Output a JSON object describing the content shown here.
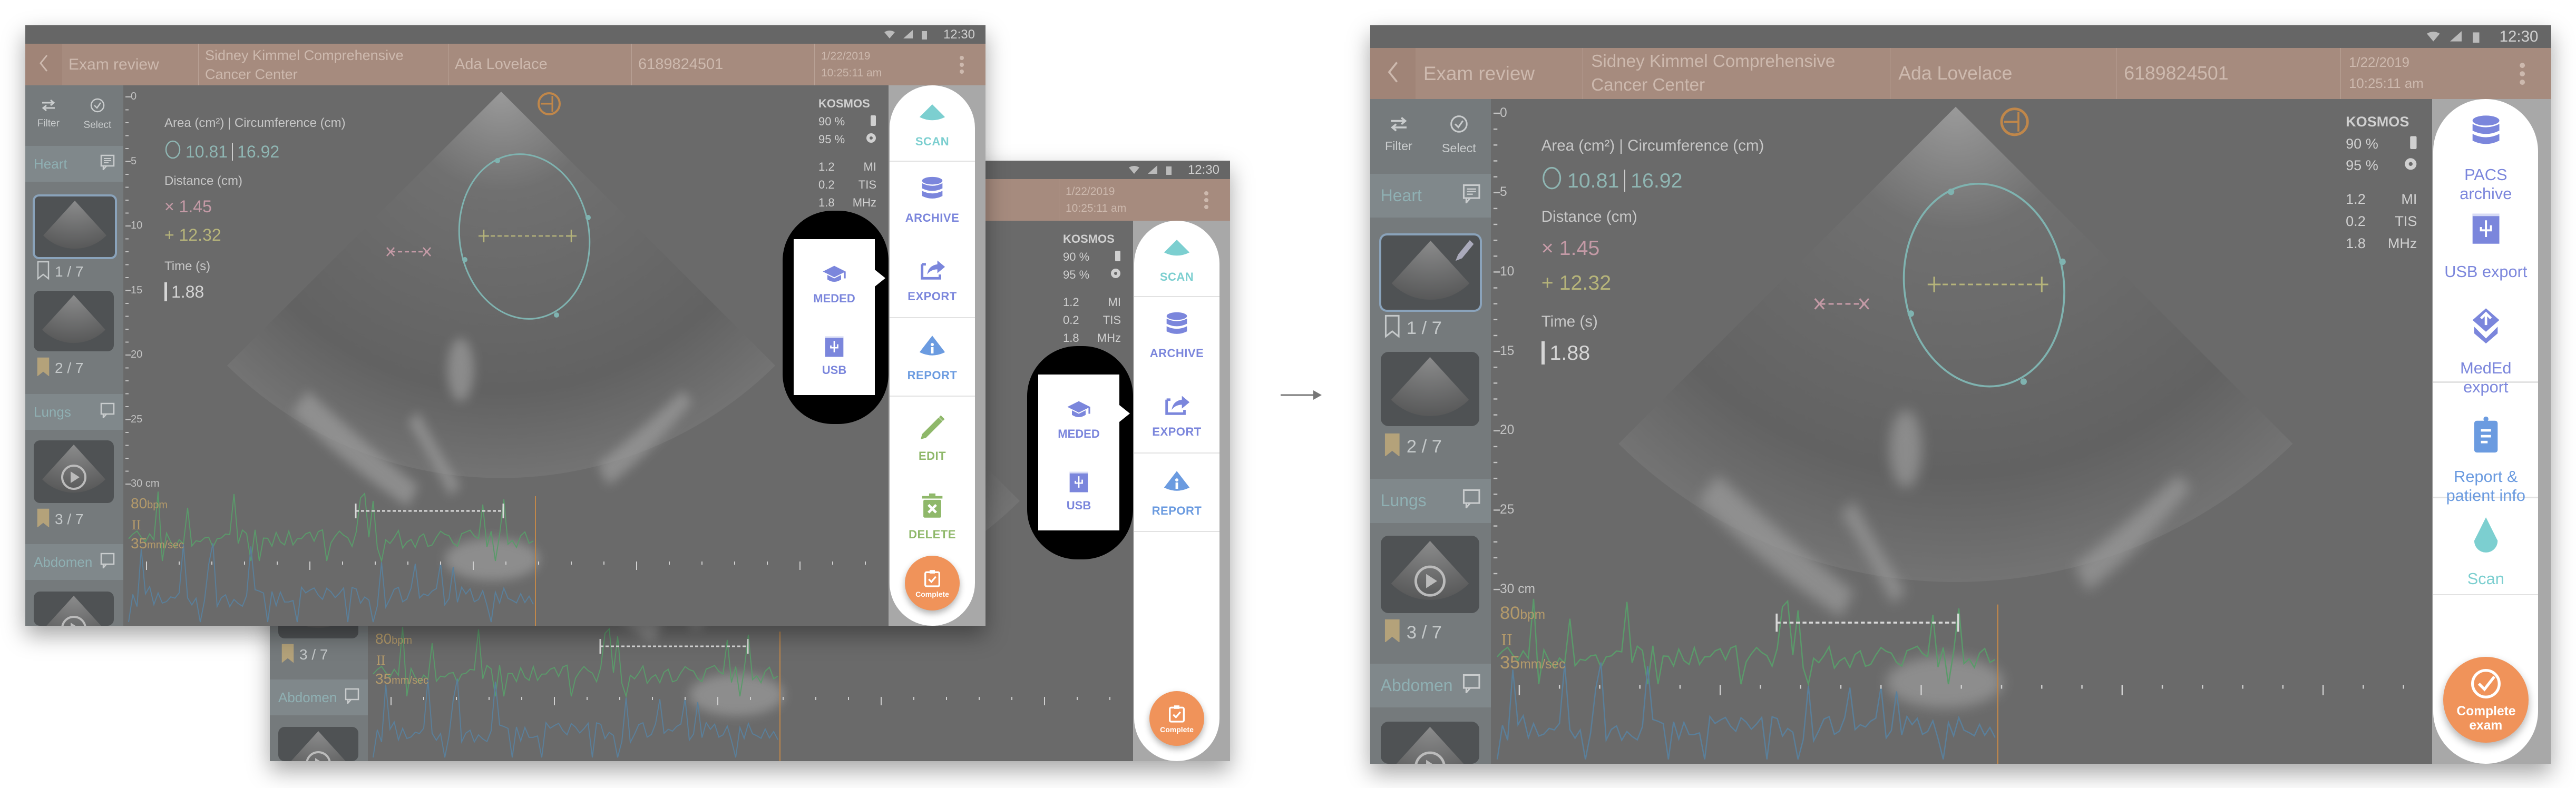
{
  "status_bar": {
    "time": "12:30",
    "icons": [
      "wifi-icon",
      "signal-icon",
      "battery-icon"
    ]
  },
  "header": {
    "back_icon": "chevron-left-icon",
    "title": "Exam review",
    "institution_line1": "Sidney Kimmel Comprehensive",
    "institution_line2": "Cancer Center",
    "patient_name": "Ada Lovelace",
    "patient_id": "6189824501",
    "date": "1/22/2019",
    "time": "10:25:11 am",
    "menu_icon": "kebab-menu-icon"
  },
  "sidebar": {
    "filter_label": "Filter",
    "select_label": "Select",
    "sections": [
      {
        "label": "Heart",
        "icon": "notes-icon"
      },
      {
        "label": "Lungs",
        "icon": "comment-icon"
      },
      {
        "label": "Abdomen",
        "icon": "comment-icon"
      }
    ],
    "counts": [
      "1 / 7",
      "2 / 7",
      "3 / 7"
    ]
  },
  "ruler": {
    "labels": [
      "0",
      "5",
      "10",
      "15",
      "20",
      "25",
      "30"
    ],
    "unit": "cm"
  },
  "measurements": {
    "area_heading": "Area (cm²) | Circumference (cm)",
    "area": "10.81",
    "circumference": "16.92",
    "distance_heading": "Distance (cm)",
    "distance_1": "1.45",
    "distance_2": "12.32",
    "time_heading": "Time (s)",
    "time": "1.88"
  },
  "device": {
    "name": "KOSMOS",
    "battery": "90 %",
    "probe": "95 %",
    "mi_value": "1.2",
    "mi_label": "MI",
    "tis_value": "0.2",
    "tis_label": "TIS",
    "freq_value": "1.8",
    "freq_label": "MHz"
  },
  "ecg": {
    "bpm": "80",
    "bpm_unit": "bpm",
    "lead": "II",
    "speed": "35",
    "speed_unit": "mm/sec"
  },
  "colors": {
    "header": "#a68b7e",
    "archive": "#7b86dc",
    "report": "#6b9be0",
    "scan": "#7ccfd0",
    "edit": "#8fb86a",
    "complete": "#f0935a",
    "ecg_trace": "#5a9a6a",
    "ellipse": "#7fb3b0"
  },
  "popover": {
    "items": [
      {
        "label": "MEDED",
        "icon": "graduation-cap-icon"
      },
      {
        "label": "USB",
        "icon": "usb-icon"
      }
    ]
  },
  "screens": [
    {
      "panel": [
        {
          "label": "SCAN",
          "icon": "scan-fan-icon",
          "color": "#7ccfd0"
        },
        {
          "label": "ARCHIVE",
          "icon": "database-icon",
          "color": "#7b86dc"
        },
        {
          "label": "EXPORT",
          "icon": "export-icon",
          "color": "#7b86dc"
        },
        {
          "label": "REPORT",
          "icon": "report-info-icon",
          "color": "#6b9be0"
        },
        {
          "label": "EDIT",
          "icon": "pencil-icon",
          "color": "#8fb86a"
        },
        {
          "label": "DELETE",
          "icon": "trash-icon",
          "color": "#8fb86a"
        }
      ],
      "complete_label": "Complete",
      "complete_icon": "clipboard-check-icon"
    },
    {
      "panel": [
        {
          "label": "SCAN",
          "icon": "scan-fan-icon",
          "color": "#7ccfd0"
        },
        {
          "label": "ARCHIVE",
          "icon": "database-icon",
          "color": "#7b86dc"
        },
        {
          "label": "EXPORT",
          "icon": "export-icon",
          "color": "#7b86dc"
        },
        {
          "label": "REPORT",
          "icon": "report-info-icon",
          "color": "#6b9be0"
        }
      ],
      "complete_label": "Complete",
      "complete_icon": "clipboard-check-icon"
    },
    {
      "panel": [
        {
          "label": "PACS archive",
          "icon": "database-icon",
          "color": "#7b86dc"
        },
        {
          "label": "USB export",
          "icon": "usb-icon",
          "color": "#7b86dc"
        },
        {
          "label": "MedEd export",
          "icon": "meded-export-icon",
          "color": "#7b86dc"
        },
        {
          "label": "Report & patient info",
          "icon": "clipboard-icon",
          "color": "#6b9be0"
        },
        {
          "label": "Scan",
          "icon": "scan-drop-icon",
          "color": "#7ccfd0"
        }
      ],
      "complete_label": "Complete exam",
      "complete_icon": "check-circle-icon"
    }
  ],
  "transition_icon": "arrow-right-icon"
}
